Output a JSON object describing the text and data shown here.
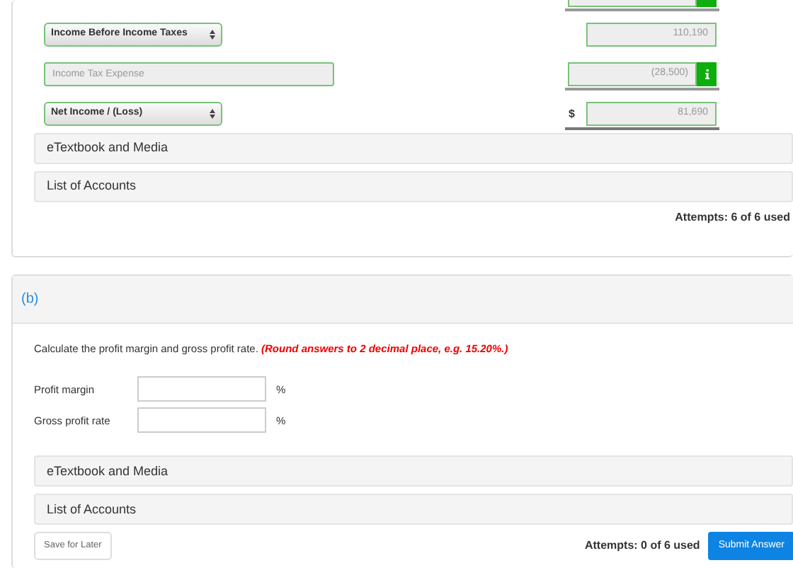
{
  "part_a": {
    "rows": [
      {
        "kind": "amount",
        "info": true,
        "underlined": true
      },
      {
        "kind": "select",
        "label": "Income Before Income Taxes",
        "amount": "110,190",
        "info": false,
        "underlined": false
      },
      {
        "kind": "input",
        "placeholder": "Income Tax Expense",
        "amount": "(28,500)",
        "info": true,
        "underlined": true
      },
      {
        "kind": "select",
        "label": "Net Income / (Loss)",
        "currency": "$",
        "amount": "81,690",
        "info": false,
        "underlined": true
      }
    ],
    "resources": [
      "eTextbook and Media",
      "List of Accounts"
    ],
    "attempts": "Attempts: 6 of 6 used"
  },
  "part_b": {
    "heading": "(b)",
    "instruction": "Calculate the profit margin and gross profit rate.",
    "hint": "(Round answers to 2 decimal place, e.g. 15.20%.)",
    "fields": [
      {
        "label": "Profit margin",
        "unit": "%"
      },
      {
        "label": "Gross profit rate",
        "unit": "%"
      }
    ],
    "resources": [
      "eTextbook and Media",
      "List of Accounts"
    ],
    "save_button": "Save for Later",
    "attempts": "Attempts: 0 of 6 used",
    "submit_button": "Submit Answer"
  }
}
